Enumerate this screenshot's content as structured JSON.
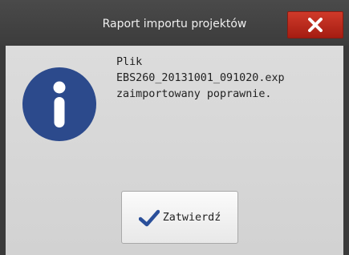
{
  "dialog": {
    "title": "Raport importu projektów",
    "close_icon": "close-icon",
    "message_icon": "info-icon",
    "message_lines": [
      "Plik",
      "EBS260_20131001_091020.exp",
      "zaimportowany poprawnie."
    ],
    "confirm_label": "Zatwierdź",
    "confirm_icon": "checkmark-icon"
  },
  "colors": {
    "titlebar": "#3c3c3c",
    "close_button": "#b52618",
    "content_background": "#d8d8d8",
    "info_icon": "#2c4a8c",
    "checkmark": "#2a4f9a"
  }
}
